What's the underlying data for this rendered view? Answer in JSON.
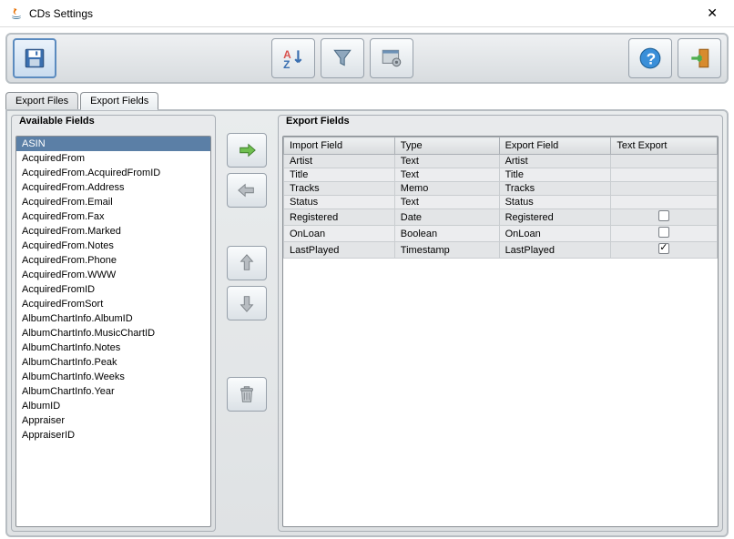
{
  "window": {
    "title": "CDs Settings"
  },
  "toolbar": {
    "save": "Save",
    "sort": "Sort A-Z",
    "filter": "Filter",
    "settings": "Settings",
    "help": "Help",
    "exit": "Exit"
  },
  "tabs": [
    {
      "id": "export-files",
      "label": "Export Files",
      "active": false
    },
    {
      "id": "export-fields",
      "label": "Export Fields",
      "active": true
    }
  ],
  "available": {
    "title": "Available Fields",
    "items": [
      "ASIN",
      "AcquiredFrom",
      "AcquiredFrom.AcquiredFromID",
      "AcquiredFrom.Address",
      "AcquiredFrom.Email",
      "AcquiredFrom.Fax",
      "AcquiredFrom.Marked",
      "AcquiredFrom.Notes",
      "AcquiredFrom.Phone",
      "AcquiredFrom.WWW",
      "AcquiredFromID",
      "AcquiredFromSort",
      "AlbumChartInfo.AlbumID",
      "AlbumChartInfo.MusicChartID",
      "AlbumChartInfo.Notes",
      "AlbumChartInfo.Peak",
      "AlbumChartInfo.Weeks",
      "AlbumChartInfo.Year",
      "AlbumID",
      "Appraiser",
      "AppraiserID"
    ],
    "selected_index": 0
  },
  "export": {
    "title": "Export Fields",
    "columns": [
      "Import Field",
      "Type",
      "Export Field",
      "Text Export"
    ],
    "rows": [
      {
        "import": "Artist",
        "type": "Text",
        "export": "Artist",
        "text": null
      },
      {
        "import": "Title",
        "type": "Text",
        "export": "Title",
        "text": null
      },
      {
        "import": "Tracks",
        "type": "Memo",
        "export": "Tracks",
        "text": null
      },
      {
        "import": "Status",
        "type": "Text",
        "export": "Status",
        "text": null
      },
      {
        "import": "Registered",
        "type": "Date",
        "export": "Registered",
        "text": false
      },
      {
        "import": "OnLoan",
        "type": "Boolean",
        "export": "OnLoan",
        "text": false
      },
      {
        "import": "LastPlayed",
        "type": "Timestamp",
        "export": "LastPlayed",
        "text": true
      }
    ]
  },
  "midbuttons": {
    "add": "Add",
    "remove": "Remove",
    "up": "Move up",
    "down": "Move down",
    "delete": "Delete"
  }
}
